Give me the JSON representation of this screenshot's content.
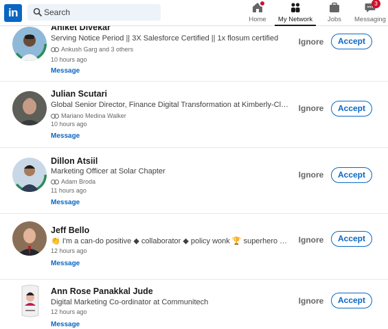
{
  "nav": {
    "logo": "in",
    "search_placeholder": "Search",
    "items": [
      {
        "label": "Home",
        "icon": "home-icon"
      },
      {
        "label": "My Network",
        "icon": "my-network-icon"
      },
      {
        "label": "Jobs",
        "icon": "briefcase-icon"
      },
      {
        "label": "Messaging",
        "icon": "messaging-icon",
        "badge": "3"
      }
    ]
  },
  "invitations": [
    {
      "name": "Aniket Divekar",
      "headline": "Serving Notice Period || 3X Salesforce Certified || 1x flosum certified",
      "mutual": "Ankush Garg and 3 others",
      "time": "10 hours ago",
      "message": "Message",
      "ignore": "Ignore",
      "accept": "Accept"
    },
    {
      "name": "Julian Scutari",
      "headline": "Global Senior Director, Finance Digital Transformation at Kimberly-Clark",
      "mutual": "Mariano Medina Walker",
      "time": "10 hours ago",
      "message": "Message",
      "ignore": "Ignore",
      "accept": "Accept"
    },
    {
      "name": "Dillon Atsiil",
      "headline": "Marketing Officer at Solar Chapter",
      "mutual": "Adam Broda",
      "time": "11 hours ago",
      "message": "Message",
      "ignore": "Ignore",
      "accept": "Accept"
    },
    {
      "name": "Jeff Bello",
      "headline": "👏 I'm a can-do positive ◆ collaborator ◆ policy wonk 🏆 superhero network...",
      "mutual": "",
      "time": "12 hours ago",
      "message": "Message",
      "ignore": "Ignore",
      "accept": "Accept"
    },
    {
      "name": "Ann Rose Panakkal Jude",
      "headline": "Digital Marketing Co-ordinator at Communitech",
      "mutual": "",
      "time": "12 hours ago",
      "message": "Message",
      "ignore": "Ignore",
      "accept": "Accept"
    }
  ],
  "colors": {
    "brand": "#0a66c2",
    "badge": "#cb112d",
    "text": "#191919",
    "muted": "#666666"
  }
}
